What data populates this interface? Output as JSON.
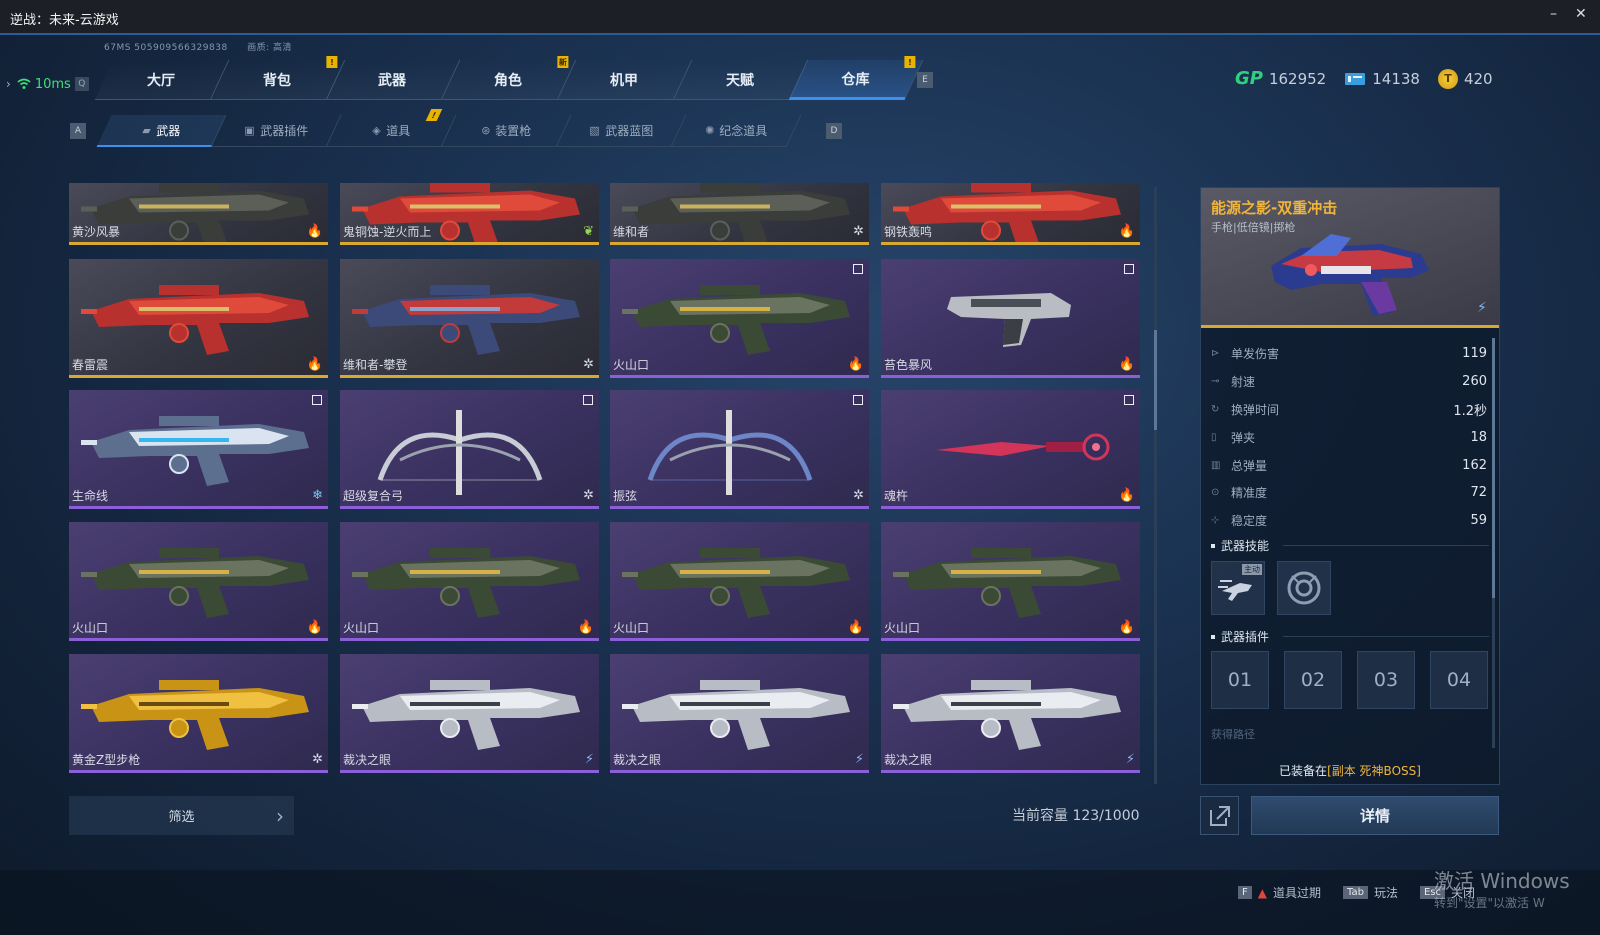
{
  "window": {
    "title": "逆战：未来-云游戏",
    "minimize": "–",
    "close": "✕"
  },
  "status": {
    "ping_id": "67MS 505909566329838",
    "quality": "画质: 高清",
    "latency": "10ms",
    "latency_key": "Q"
  },
  "main_tabs": [
    {
      "label": "大厅",
      "badge": ""
    },
    {
      "label": "背包",
      "badge": "!"
    },
    {
      "label": "武器",
      "badge": ""
    },
    {
      "label": "角色",
      "badge": "新"
    },
    {
      "label": "机甲",
      "badge": ""
    },
    {
      "label": "天赋",
      "badge": ""
    },
    {
      "label": "仓库",
      "badge": "!",
      "active": true
    }
  ],
  "keys": {
    "e": "E",
    "a": "A",
    "d": "D"
  },
  "currencies": {
    "gp_label": "GP",
    "gp": "162952",
    "ticket": "14138",
    "coin_symbol": "T",
    "coin": "420"
  },
  "sub_tabs": [
    {
      "label": "武器",
      "icon": "rifle-icon",
      "active": true
    },
    {
      "label": "武器插件",
      "icon": "chip-icon"
    },
    {
      "label": "道具",
      "icon": "item-icon",
      "badge": "!"
    },
    {
      "label": "装置枪",
      "icon": "device-icon"
    },
    {
      "label": "武器蓝图",
      "icon": "blueprint-icon"
    },
    {
      "label": "纪念道具",
      "icon": "medal-icon"
    }
  ],
  "weapons": [
    {
      "name": "黄沙风暴",
      "rarity": "gold",
      "rank": "fire",
      "style": "rifle-dark"
    },
    {
      "name": "鬼铜蚀-逆火而上",
      "rarity": "gold",
      "rank": "leaf",
      "style": "rifle-red"
    },
    {
      "name": "维和者",
      "rarity": "gold",
      "rank": "star",
      "style": "rifle-dark"
    },
    {
      "name": "钢铁轰鸣",
      "rarity": "gold",
      "rank": "fire",
      "style": "rifle-red"
    },
    {
      "name": "春雷震",
      "rarity": "gold",
      "rank": "fire",
      "style": "rifle-red",
      "check": false
    },
    {
      "name": "维和者-攀登",
      "rarity": "gold",
      "rank": "star",
      "style": "rifle-blue"
    },
    {
      "name": "火山口",
      "rarity": "purple",
      "rank": "fire",
      "style": "rifle-green",
      "check": true
    },
    {
      "name": "苔色暴风",
      "rarity": "purple",
      "rank": "fire",
      "style": "pistol",
      "check": true
    },
    {
      "name": "生命线",
      "rarity": "purple",
      "rank": "ice",
      "style": "rifle-cyan",
      "check": true
    },
    {
      "name": "超级复合弓",
      "rarity": "purple",
      "rank": "star",
      "style": "bow-gray",
      "check": true
    },
    {
      "name": "振弦",
      "rarity": "purple",
      "rank": "star",
      "style": "bow-blue",
      "check": true
    },
    {
      "name": "魂杵",
      "rarity": "purple",
      "rank": "fire",
      "style": "staff",
      "check": true
    },
    {
      "name": "火山口",
      "rarity": "purple",
      "rank": "fire",
      "style": "rifle-green"
    },
    {
      "name": "火山口",
      "rarity": "purple",
      "rank": "fire",
      "style": "rifle-green"
    },
    {
      "name": "火山口",
      "rarity": "purple",
      "rank": "fire",
      "style": "rifle-green"
    },
    {
      "name": "火山口",
      "rarity": "purple",
      "rank": "fire",
      "style": "rifle-green"
    },
    {
      "name": "黄金Z型步枪",
      "rarity": "purple",
      "rank": "star",
      "style": "rifle-gold"
    },
    {
      "name": "裁决之眼",
      "rarity": "purple",
      "rank": "bolt",
      "style": "rifle-white"
    },
    {
      "name": "裁决之眼",
      "rarity": "purple",
      "rank": "bolt",
      "style": "rifle-white"
    },
    {
      "name": "裁决之眼",
      "rarity": "purple",
      "rank": "bolt",
      "style": "rifle-white"
    }
  ],
  "filter": {
    "label": "筛选",
    "chevron": "›"
  },
  "capacity": "当前容量 123/1000",
  "detail": {
    "name": "能源之影-双重冲击",
    "type": "手枪|低倍镜|掷枪",
    "stats": [
      {
        "label": "单发伤害",
        "value": "119"
      },
      {
        "label": "射速",
        "value": "260"
      },
      {
        "label": "换弹时间",
        "value": "1.2秒"
      },
      {
        "label": "弹夹",
        "value": "18"
      },
      {
        "label": "总弹量",
        "value": "162"
      },
      {
        "label": "精准度",
        "value": "72"
      },
      {
        "label": "稳定度",
        "value": "59"
      }
    ],
    "skills_title": "武器技能",
    "skill_tag": "主动",
    "plugins_title": "武器插件",
    "plugin_slots": [
      "01",
      "02",
      "03",
      "04"
    ],
    "faded_text": "获得路径",
    "equipped_prefix": "已装备在",
    "equipped_location": "[副本 死神BOSS]",
    "detail_button": "详情"
  },
  "footer": {
    "expire_key": "F",
    "expire_label": "道具过期",
    "play_key": "Tab",
    "play_label": "玩法",
    "close_key": "Esc",
    "close_label": "关闭"
  },
  "watermark": {
    "line1": "激活 Windows",
    "line2": "转到\"设置\"以激活 W"
  }
}
